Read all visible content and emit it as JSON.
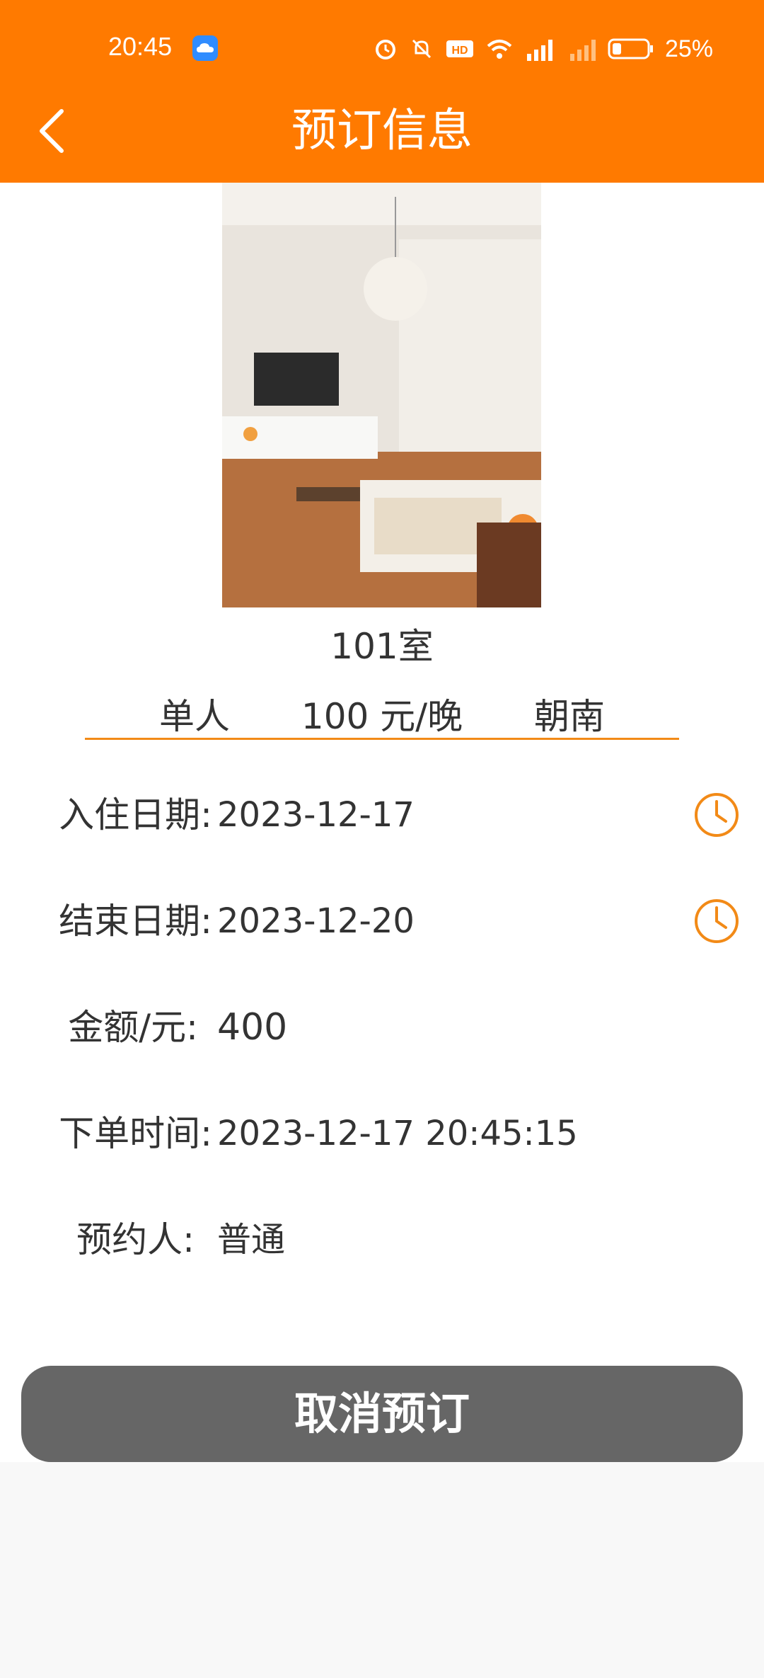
{
  "status_bar": {
    "time": "20:45",
    "battery": "25%",
    "icons": [
      "cloud-app-icon",
      "alarm-icon",
      "mute-icon",
      "hd-icon",
      "wifi-icon",
      "signal-4g-icon",
      "signal-icon",
      "battery-icon"
    ]
  },
  "header": {
    "title": "预订信息",
    "back_icon": "chevron-left-icon",
    "background": "#ff7a00"
  },
  "room": {
    "name": "101室",
    "type": "单人",
    "price": "100 元/晚",
    "orientation": "朝南",
    "photo": "living-room-photo"
  },
  "details": {
    "checkin_label": "入住日期:",
    "checkin_value": "2023-12-17",
    "checkout_label": "结束日期:",
    "checkout_value": "2023-12-20",
    "amount_label": "金额/元:",
    "amount_value": "400",
    "order_time_label": "下单时间:",
    "order_time_value": "2023-12-17 20:45:15",
    "booker_label": "预约人:",
    "booker_value": "普通"
  },
  "actions": {
    "cancel_label": "取消预订",
    "cancel_color": "#666666"
  },
  "colors": {
    "accent": "#ff7a00",
    "divider": "#f28a17"
  }
}
